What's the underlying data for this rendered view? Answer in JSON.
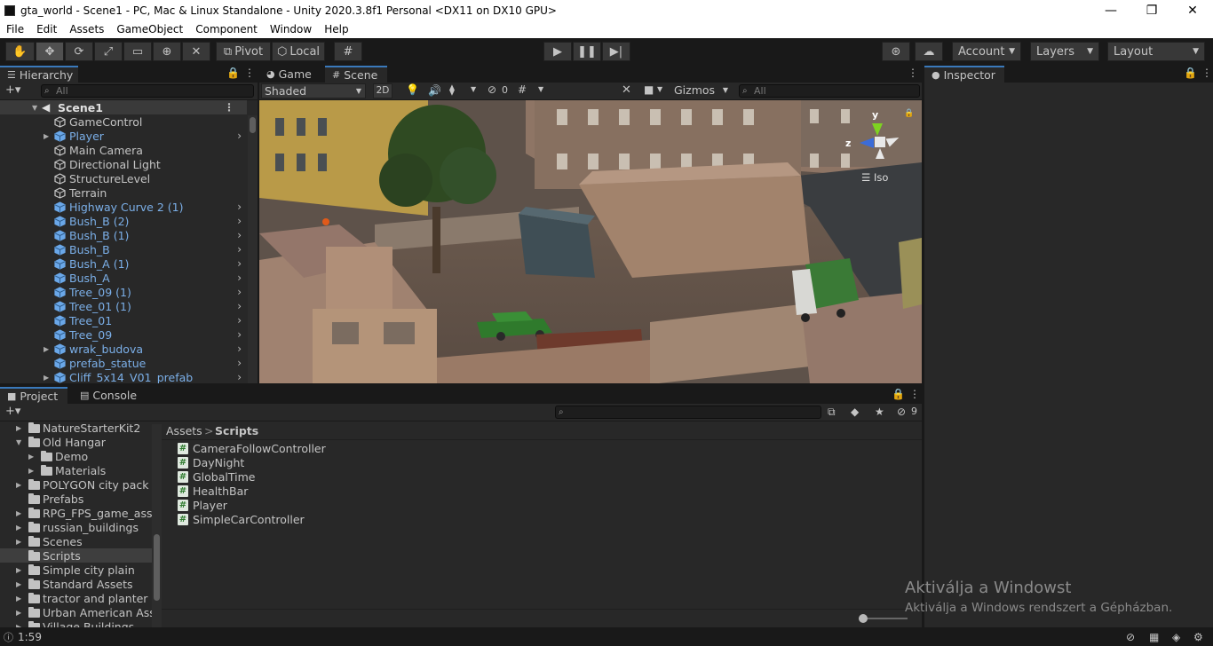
{
  "window": {
    "title": "gta_world - Scene1 - PC, Mac & Linux Standalone - Unity 2020.3.8f1 Personal <DX11 on DX10 GPU>",
    "minimize": "—",
    "maximize": "❐",
    "close": "✕"
  },
  "menu": [
    "File",
    "Edit",
    "Assets",
    "GameObject",
    "Component",
    "Window",
    "Help"
  ],
  "toolbar": {
    "pivot": "Pivot",
    "local": "Local",
    "account": "Account",
    "layers": "Layers",
    "layout": "Layout"
  },
  "hierarchy": {
    "tab": "Hierarchy",
    "search_placeholder": "All",
    "scene": "Scene1",
    "items": [
      {
        "name": "GameControl",
        "prefab": false,
        "fold": false,
        "chev": false
      },
      {
        "name": "Player",
        "prefab": true,
        "fold": true,
        "chev": true
      },
      {
        "name": "Main Camera",
        "prefab": false,
        "fold": false,
        "chev": false
      },
      {
        "name": "Directional Light",
        "prefab": false,
        "fold": false,
        "chev": false
      },
      {
        "name": "StructureLevel",
        "prefab": false,
        "fold": false,
        "chev": false
      },
      {
        "name": "Terrain",
        "prefab": false,
        "fold": false,
        "chev": false
      },
      {
        "name": "Highway Curve 2 (1)",
        "prefab": true,
        "fold": false,
        "chev": true
      },
      {
        "name": "Bush_B (2)",
        "prefab": true,
        "fold": false,
        "chev": true
      },
      {
        "name": "Bush_B (1)",
        "prefab": true,
        "fold": false,
        "chev": true
      },
      {
        "name": "Bush_B",
        "prefab": true,
        "fold": false,
        "chev": true
      },
      {
        "name": "Bush_A (1)",
        "prefab": true,
        "fold": false,
        "chev": true
      },
      {
        "name": "Bush_A",
        "prefab": true,
        "fold": false,
        "chev": true
      },
      {
        "name": "Tree_09 (1)",
        "prefab": true,
        "fold": false,
        "chev": true
      },
      {
        "name": "Tree_01 (1)",
        "prefab": true,
        "fold": false,
        "chev": true
      },
      {
        "name": "Tree_01",
        "prefab": true,
        "fold": false,
        "chev": true
      },
      {
        "name": "Tree_09",
        "prefab": true,
        "fold": false,
        "chev": true
      },
      {
        "name": "wrak_budova",
        "prefab": true,
        "fold": true,
        "chev": true
      },
      {
        "name": "prefab_statue",
        "prefab": true,
        "fold": false,
        "chev": true
      },
      {
        "name": "Cliff_5x14_V01_prefab",
        "prefab": true,
        "fold": true,
        "chev": true
      }
    ]
  },
  "sceneview": {
    "tab_game": "Game",
    "tab_scene": "Scene",
    "shading": "Shaded",
    "mode2d": "2D",
    "hidden_count": "0",
    "gizmos": "Gizmos",
    "search_placeholder": "All",
    "axis_y": "y",
    "axis_z": "z",
    "projection": "Iso"
  },
  "inspector": {
    "tab": "Inspector"
  },
  "project": {
    "tab_project": "Project",
    "tab_console": "Console",
    "breadcrumb_root": "Assets",
    "breadcrumb_sep": ">",
    "breadcrumb_current": "Scripts",
    "hidden_count": "9",
    "folders": [
      {
        "name": "NatureStarterKit2",
        "indent": 0,
        "fold": "▶",
        "selected": false
      },
      {
        "name": "Old Hangar",
        "indent": 0,
        "fold": "▼",
        "selected": false
      },
      {
        "name": "Demo",
        "indent": 1,
        "fold": "▶",
        "selected": false
      },
      {
        "name": "Materials",
        "indent": 1,
        "fold": "▶",
        "selected": false
      },
      {
        "name": "POLYGON city pack",
        "indent": 0,
        "fold": "▶",
        "selected": false
      },
      {
        "name": "Prefabs",
        "indent": 0,
        "fold": "",
        "selected": false
      },
      {
        "name": "RPG_FPS_game_asse",
        "indent": 0,
        "fold": "▶",
        "selected": false
      },
      {
        "name": "russian_buildings",
        "indent": 0,
        "fold": "▶",
        "selected": false
      },
      {
        "name": "Scenes",
        "indent": 0,
        "fold": "▶",
        "selected": false
      },
      {
        "name": "Scripts",
        "indent": 0,
        "fold": "",
        "selected": true
      },
      {
        "name": "Simple city plain",
        "indent": 0,
        "fold": "▶",
        "selected": false
      },
      {
        "name": "Standard Assets",
        "indent": 0,
        "fold": "▶",
        "selected": false
      },
      {
        "name": "tractor and planter",
        "indent": 0,
        "fold": "▶",
        "selected": false
      },
      {
        "name": "Urban American Asse",
        "indent": 0,
        "fold": "▶",
        "selected": false
      },
      {
        "name": "Village Buildings",
        "indent": 0,
        "fold": "▶",
        "selected": false
      }
    ],
    "files": [
      "CameraFollowController",
      "DayNight",
      "GlobalTime",
      "HealthBar",
      "Player",
      "SimpleCarController"
    ]
  },
  "status": {
    "text": "1:59"
  },
  "watermark": {
    "line1": "Aktiválja a Windowst",
    "line2": "Aktiválja a Windows rendszert a Gépházban."
  }
}
